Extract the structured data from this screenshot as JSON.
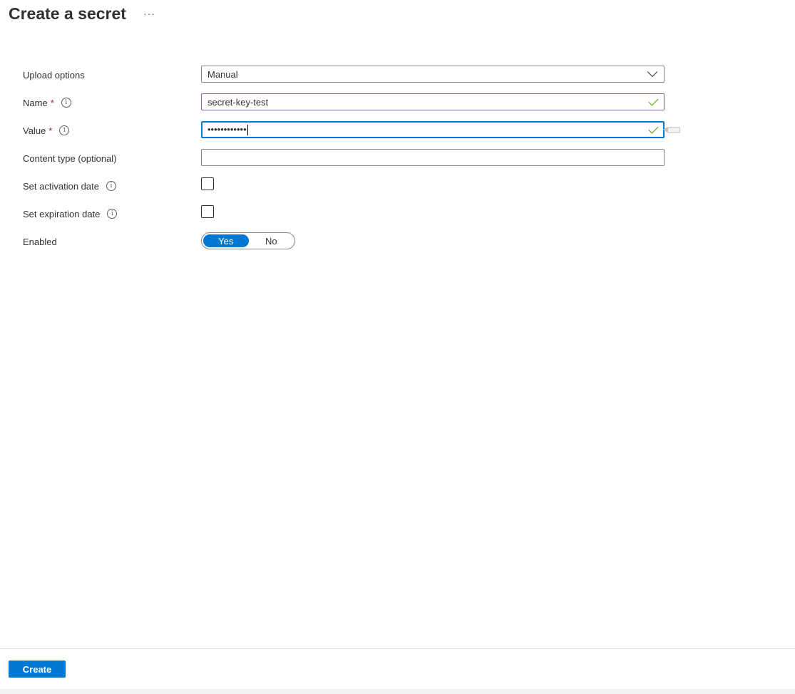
{
  "header": {
    "title": "Create a secret",
    "more_label": "···"
  },
  "form": {
    "upload_options": {
      "label": "Upload options",
      "value": "Manual"
    },
    "name": {
      "label": "Name",
      "required_mark": "*",
      "info_glyph": "i",
      "value": "secret-key-test",
      "valid": true
    },
    "value": {
      "label": "Value",
      "required_mark": "*",
      "info_glyph": "i",
      "masked_value": "••••••••••••",
      "valid": true
    },
    "content_type": {
      "label": "Content type (optional)",
      "value": ""
    },
    "activation_date": {
      "label": "Set activation date",
      "info_glyph": "i",
      "checked": false
    },
    "expiration_date": {
      "label": "Set expiration date",
      "info_glyph": "i",
      "checked": false
    },
    "enabled": {
      "label": "Enabled",
      "yes_label": "Yes",
      "no_label": "No",
      "selected": "Yes"
    }
  },
  "footer": {
    "create_label": "Create"
  },
  "colors": {
    "accent": "#0078d4",
    "required": "#a4262c",
    "valid_check": "#57a300",
    "name_border": "#8764b8"
  },
  "icons": {
    "more": "more-horizontal-icon",
    "dropdown": "chevron-down-icon",
    "info": "info-icon",
    "valid": "checkmark-icon",
    "password_reveal": "password-reveal-icon"
  }
}
